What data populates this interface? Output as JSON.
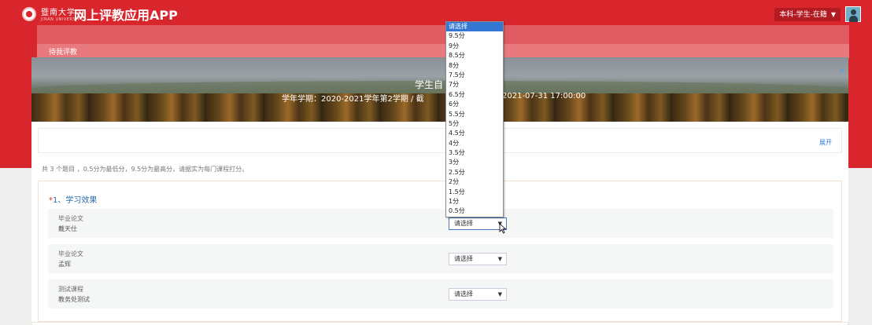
{
  "header": {
    "university_name": "暨南大学",
    "university_sub": "JINAN UNIVERSITY",
    "app_title": "网上评教应用APP",
    "user_role": "本科-学生-在籍"
  },
  "tabs": {
    "pending": "待我评教"
  },
  "banner": {
    "title": "学生自",
    "term": "学年学期：2020-2021学年第2学期 / 截",
    "deadline": "2021-07-31 17:00:00"
  },
  "collapse": {
    "expand_label": "展开"
  },
  "description": "共 3 个题目 ，0.5分为最低分，9.5分为最高分，请据实为每门课程打分。",
  "section": {
    "required_mark": "*",
    "title": "1、学习效果",
    "rows": [
      {
        "course": "毕业论文",
        "teacher": "戴天仕",
        "value": "请选择"
      },
      {
        "course": "毕业论文",
        "teacher": "孟辉",
        "value": "请选择"
      },
      {
        "course": "测试课程",
        "teacher": "教务处测试",
        "value": "请选择"
      }
    ]
  },
  "dropdown": {
    "options": [
      "请选择",
      "9.5分",
      "9分",
      "8.5分",
      "8分",
      "7.5分",
      "7分",
      "6.5分",
      "6分",
      "5.5分",
      "5分",
      "4.5分",
      "4分",
      "3.5分",
      "3分",
      "2.5分",
      "2分",
      "1.5分",
      "1分",
      "0.5分"
    ],
    "selected_index": 0
  },
  "colors": {
    "brand_red": "#d9252c",
    "link_blue": "#2f7cd8",
    "highlight_blue": "#3478d4"
  }
}
